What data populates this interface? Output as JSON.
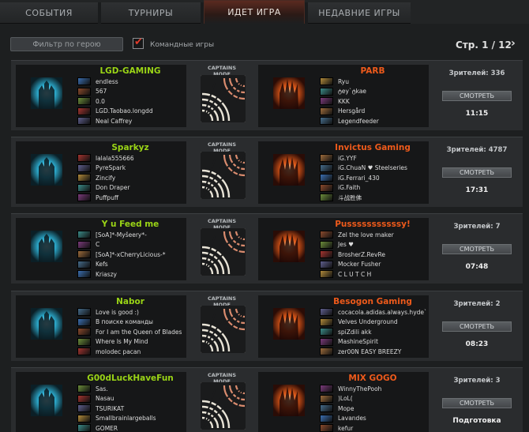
{
  "tabs": [
    {
      "label": "СОБЫТИЯ",
      "active": false
    },
    {
      "label": "ТУРНИРЫ",
      "active": false
    },
    {
      "label": "ИДЕТ ИГРА",
      "active": true
    },
    {
      "label": "НЕДАВНИЕ ИГРЫ",
      "active": false
    }
  ],
  "filter": {
    "placeholder": "Фильтр по герою"
  },
  "team_games": {
    "label": "Командные игры",
    "checked": true
  },
  "pager": {
    "text": "Стр. 1 / 12"
  },
  "colors": {
    "accent": "#e23b2b",
    "radiant_name": "#9ad416",
    "dire_name": "#ee5a1b"
  },
  "games": [
    {
      "radiant": {
        "name": "LGD-GAMING",
        "players": [
          "endless",
          "567",
          "0.0",
          "LGD.Taobao.longdd",
          "Neal Caffrey"
        ]
      },
      "mode": "CAPTAINS MODE",
      "dire": {
        "name": "PARB",
        "players": [
          "Ryu",
          "ტey`ტkae",
          "KKK",
          "Hersgård",
          "Legendfeeder"
        ]
      },
      "viewers": "Зрителей: 336",
      "watch": "СМОТРЕТЬ",
      "time": "11:15"
    },
    {
      "radiant": {
        "name": "Sparkyz",
        "players": [
          "lalala555666",
          "PyreSpark",
          "Zincify",
          "Don Draper",
          "Puffpuff"
        ]
      },
      "mode": "CAPTAINS MODE",
      "dire": {
        "name": "Invictus Gaming",
        "players": [
          "iG.YYF",
          "iG.ChuaN ♥ Steelseries",
          "iG.Ferrari_430",
          "iG.Faith",
          "斗战胜佛"
        ]
      },
      "viewers": "Зрителей: 4787",
      "watch": "СМОТРЕТЬ",
      "time": "17:31"
    },
    {
      "radiant": {
        "name": "Y u Feed me",
        "players": [
          "[SoA]*-Myšeery*-",
          "C",
          "[SoA]*-xCherryLicious-*",
          "Kefs",
          "Kriaszy"
        ]
      },
      "mode": "CAPTAINS MODE",
      "dire": {
        "name": "Pusssssssssssy!",
        "players": [
          "Zel the love maker",
          "Jes ♥",
          "BrosherZ.RevRe",
          "Mocker Fusher",
          "C L U T C H"
        ]
      },
      "viewers": "Зрителей: 7",
      "watch": "СМОТРЕТЬ",
      "time": "07:48"
    },
    {
      "radiant": {
        "name": "Nabor",
        "players": [
          "Love is good :)",
          "В поиске команды",
          "For I am the Queen of Blades",
          "Where Is My Mind",
          "molodec pacan"
        ]
      },
      "mode": "CAPTAINS MODE",
      "dire": {
        "name": "Besogon Gaming",
        "players": [
          "cocacola.adidas.always.hyde`",
          "Velves Underground",
          "spiZdili akk",
          "MashineSpirit",
          "zer00N EASY BREEZY"
        ]
      },
      "viewers": "Зрителей: 2",
      "watch": "СМОТРЕТЬ",
      "time": "08:23"
    },
    {
      "radiant": {
        "name": "G00dLuckHaveFun",
        "players": [
          "Sas.",
          "Nasau",
          "TSURIKAT",
          "Smallbrainlargeballs",
          "GOMER"
        ]
      },
      "mode": "CAPTAINS MODE",
      "dire": {
        "name": "MIX GOGO",
        "players": [
          "WinnyThePooh",
          ")LoL(",
          "Mope",
          "Lavandes",
          "kefur"
        ]
      },
      "viewers": "Зрителей: 3",
      "watch": "СМОТРЕТЬ",
      "time": "Подготовка"
    }
  ]
}
